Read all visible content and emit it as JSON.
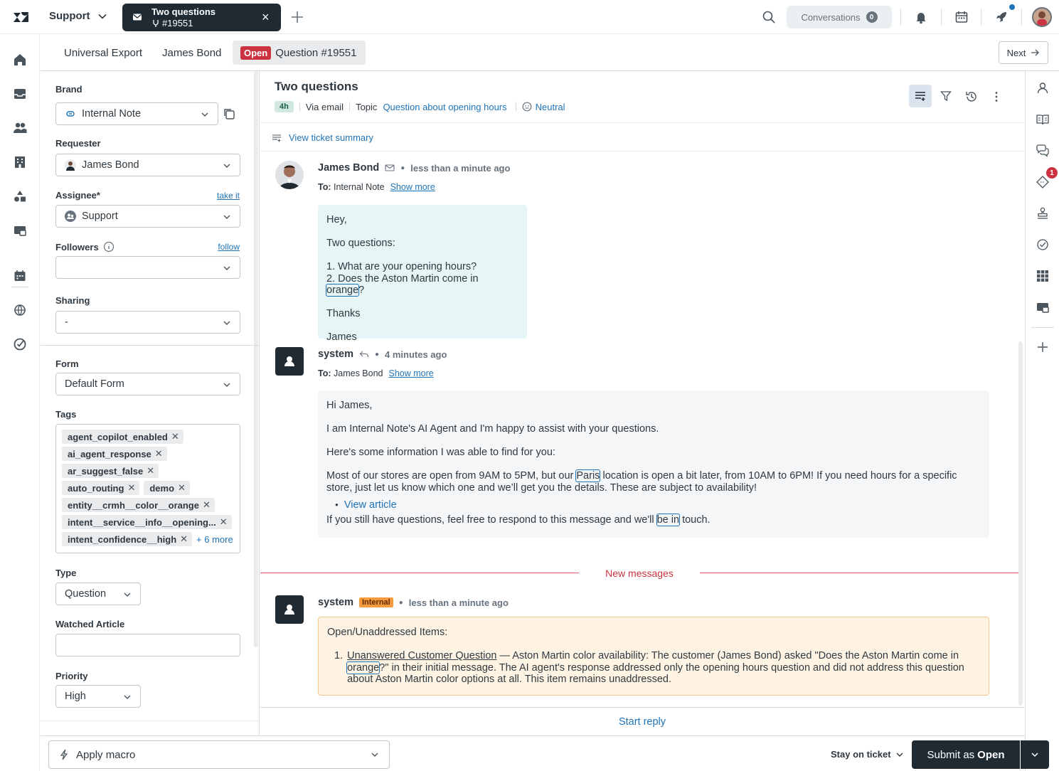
{
  "topbar": {
    "product": "Support",
    "active_tab": {
      "title": "Two questions",
      "ticket": "#19551",
      "close": "×"
    },
    "conversations_label": "Conversations",
    "conversations_count": "0"
  },
  "breadcrumbs": {
    "item1": "Universal Export",
    "item2": "James Bond",
    "status_badge": "Open",
    "item3": "Question #19551",
    "next_label": "Next"
  },
  "properties": {
    "brand_label": "Brand",
    "brand_value": "Internal Note",
    "requester_label": "Requester",
    "requester_value": "James Bond",
    "assignee_label": "Assignee*",
    "assignee_link": "take it",
    "assignee_value": "Support",
    "followers_label": "Followers",
    "followers_link": "follow",
    "followers_value": "",
    "sharing_label": "Sharing",
    "sharing_value": "-",
    "form_label": "Form",
    "form_value": "Default Form",
    "tags_label": "Tags",
    "tags": [
      "agent_copilot_enabled",
      "ai_agent_response",
      "ar_suggest_false",
      "auto_routing",
      "demo",
      "entity__crmh__color__orange",
      "intent__service__info__opening...",
      "intent_confidence__high"
    ],
    "tags_more": "+ 6 more",
    "type_label": "Type",
    "type_value": "Question",
    "watched_label": "Watched Article",
    "watched_value": "",
    "priority_label": "Priority",
    "priority_value": "High"
  },
  "conversation": {
    "title": "Two questions",
    "age_badge": "4h",
    "channel": "Via email",
    "topic_label": "Topic",
    "topic_value": "Question about opening hours",
    "sentiment": "Neutral",
    "summary_link": "View ticket summary",
    "messages": [
      {
        "author": "James Bond",
        "time": "less than a minute ago",
        "to_label": "To:",
        "to_value": "Internal Note",
        "show_more": "Show more",
        "body": {
          "l1": "Hey,",
          "l2": "Two questions:",
          "l3": "1. What are your opening hours?",
          "l4a": "2. Does the Aston Martin come in ",
          "l4b": "orange",
          "l4c": "?",
          "l5": "Thanks",
          "l6": "James"
        }
      },
      {
        "author": "system",
        "time": "4 minutes ago",
        "to_label": "To:",
        "to_value": "James Bond",
        "show_more": "Show more",
        "body": {
          "l1": "Hi James,",
          "l2": "I am Internal Note's AI Agent and I'm happy to assist with your questions.",
          "l3": "Here's some information I was able to find for you:",
          "l4a": "Most of our stores are open from 9AM to 5PM, but our ",
          "l4b": "Paris",
          "l4c": " location is open a bit later, from 10AM to 6PM! If you need hours for a specific store, just let us know which one and we’ll get you the details. These are subject to availability!",
          "bullet": "View article",
          "l5a": "If you still have questions, feel free to respond to this message and we'll ",
          "l5b": "be in",
          "l5c": " touch."
        }
      },
      {
        "author": "system",
        "badge": "Internal",
        "time": "less than a minute ago",
        "body": {
          "heading": "Open/Unaddressed Items:",
          "item_num": "1.",
          "item_a": "Unanswered Customer Question",
          "item_b": " — Aston Martin color availability: The customer (James Bond) asked \"Does the Aston Martin come in ",
          "item_c": "orange",
          "item_d": "?\" in their initial message. The AI agent's response addressed only the opening hours question and did not address this question about Aston Martin color options at all. This item remains unaddressed."
        }
      }
    ],
    "new_messages_label": "New messages",
    "start_reply": "Start reply"
  },
  "rightrail": {
    "badge_count": "1"
  },
  "footer": {
    "macro_label": "Apply macro",
    "stay_label": "Stay on ticket",
    "submit_prefix": "Submit as",
    "submit_status": "Open"
  },
  "colors": {
    "accent": "#1f73b7",
    "dark": "#1f2a33",
    "open_status": "#cc3340",
    "internal_badge": "#f79a3e",
    "end_user_bubble": "#e6f5f6",
    "internal_bubble": "#fff3e3"
  },
  "icons": [
    "zendesk-logo-icon",
    "chevron-down-icon",
    "mail-icon",
    "merge-icon",
    "close-icon",
    "plus-icon",
    "search-icon",
    "bell-icon",
    "calendar-icon",
    "rocket-icon",
    "home-icon",
    "inbox-icon",
    "users-icon",
    "building-icon",
    "shapes-icon",
    "card-icon",
    "globe-icon",
    "check-circle-icon",
    "copy-icon",
    "info-icon",
    "arrow-right-icon",
    "summary-icon",
    "filter-icon",
    "history-icon",
    "more-vertical-icon",
    "smiley-icon",
    "envelope-icon",
    "reply-icon",
    "person-icon",
    "book-icon",
    "chat-icon",
    "ticket-icon",
    "stamp-icon",
    "grid-icon",
    "lightning-icon"
  ]
}
